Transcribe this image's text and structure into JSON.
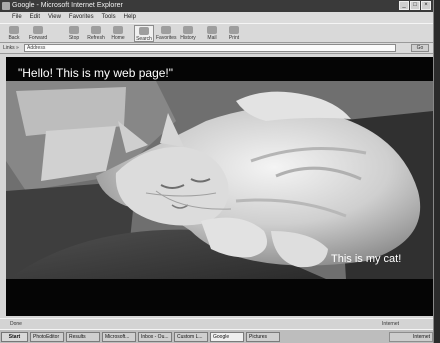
{
  "window": {
    "title": "Google - Microsoft Internet Explorer",
    "menu": [
      "File",
      "Edit",
      "View",
      "Favorites",
      "Tools",
      "Help"
    ],
    "controls": [
      "_",
      "□",
      "×"
    ]
  },
  "toolbar": {
    "back": "Back",
    "forward": "Forward",
    "stop": "Stop",
    "refresh": "Refresh",
    "home": "Home",
    "search": "Search",
    "favorites": "Favorites",
    "history": "History",
    "mail": "Mail",
    "print": "Print"
  },
  "address": {
    "label": "Links »",
    "value": "Address",
    "go": "Go"
  },
  "page": {
    "heading": "\"Hello! This is my web page!\"",
    "caption": "This is my cat!"
  },
  "status": {
    "text": "Done",
    "zone": "Internet"
  },
  "taskbar": {
    "start": "Start",
    "items": [
      "Start",
      "PhotoEditor",
      "Results",
      "Microsoft...",
      "Inbox - Ou...",
      "Custom L...",
      "Google",
      "Pictures"
    ],
    "tray": "Internet"
  }
}
